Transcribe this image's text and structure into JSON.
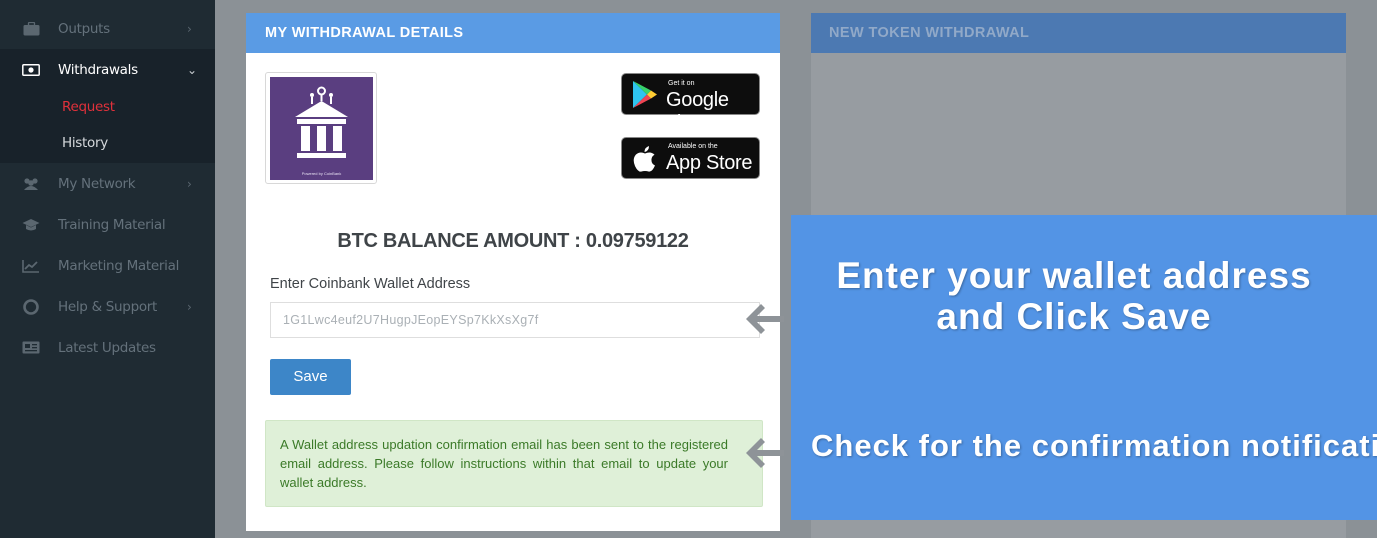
{
  "sidebar": {
    "items": [
      {
        "label": "Outputs",
        "icon": "briefcase-icon"
      },
      {
        "label": "Withdrawals",
        "icon": "money-icon"
      },
      {
        "label": "My Network",
        "icon": "users-icon"
      },
      {
        "label": "Training Material",
        "icon": "graduation-cap-icon"
      },
      {
        "label": "Marketing Material",
        "icon": "line-chart-icon"
      },
      {
        "label": "Help & Support",
        "icon": "life-ring-icon"
      },
      {
        "label": "Latest Updates",
        "icon": "newspaper-icon"
      }
    ],
    "withdrawals_sub": {
      "request": "Request",
      "history": "History"
    }
  },
  "withdrawal_card": {
    "title": "MY WITHDRAWAL DETAILS",
    "logo_caption": "Powered by CoinBank",
    "google_play": {
      "small": "Get it on",
      "big": "Google play"
    },
    "app_store": {
      "small": "Available on the",
      "big": "App Store"
    },
    "balance": "BTC BALANCE AMOUNT : 0.09759122",
    "address_label": "Enter Coinbank Wallet Address",
    "address_value": "1G1Lwc4euf2U7HugpJEopEYSp7KkXsXg7f",
    "save_label": "Save",
    "alert_text": "A Wallet address updation confirmation email has been sent to the registered email address. Please follow instructions within that email to update your wallet address."
  },
  "token_card": {
    "title": "NEW TOKEN WITHDRAWAL"
  },
  "callout": {
    "line1": "Enter your wallet address\nand Click Save",
    "line2": "Check for the confirmation notification"
  },
  "colors": {
    "sidebar_bg": "#1f2b33",
    "header_blue": "#5a9be4",
    "callout_blue": "#5394e5",
    "save_blue": "#3d86c8",
    "alert_green_bg": "#dff0d8",
    "active_sub": "#e0313b"
  }
}
